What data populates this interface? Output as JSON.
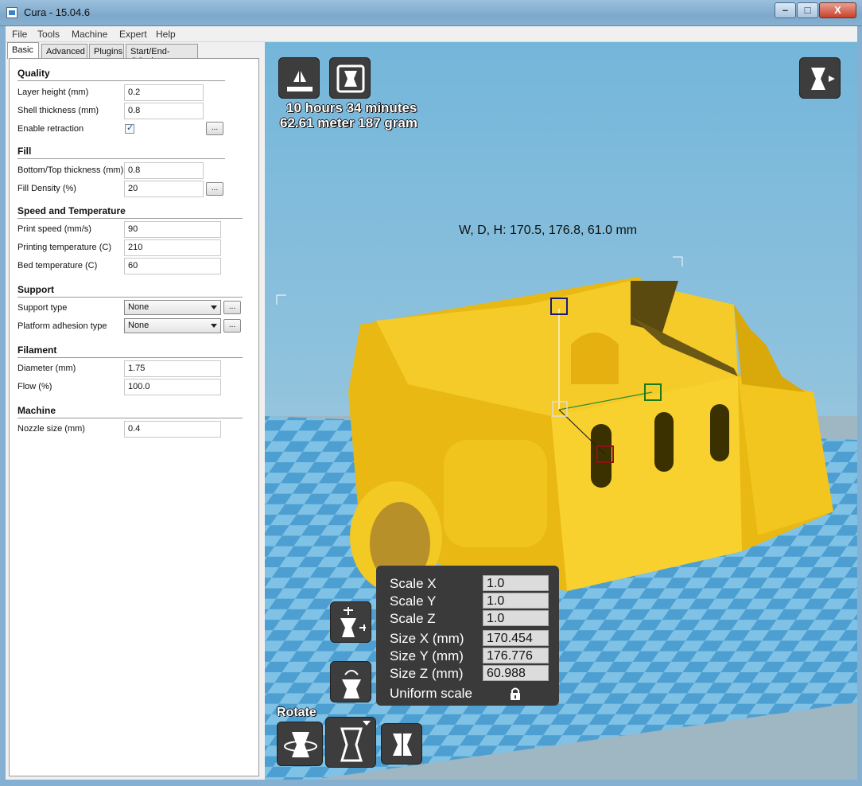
{
  "window": {
    "title": "Cura - 15.04.6",
    "min_label": "–",
    "max_label": "□",
    "close_label": "X"
  },
  "menu": [
    "File",
    "Tools",
    "Machine",
    "Expert",
    "Help"
  ],
  "tabs": [
    "Basic",
    "Advanced",
    "Plugins",
    "Start/End-GCode"
  ],
  "sections": {
    "quality": "Quality",
    "fill": "Fill",
    "speed": "Speed and Temperature",
    "support": "Support",
    "filament": "Filament",
    "machine": "Machine"
  },
  "fields": {
    "layer_height": {
      "label": "Layer height (mm)",
      "value": "0.2"
    },
    "shell_thickness": {
      "label": "Shell thickness (mm)",
      "value": "0.8"
    },
    "enable_retraction": {
      "label": "Enable retraction",
      "checked": true
    },
    "bottom_top": {
      "label": "Bottom/Top thickness (mm)",
      "value": "0.8"
    },
    "fill_density": {
      "label": "Fill Density (%)",
      "value": "20"
    },
    "print_speed": {
      "label": "Print speed (mm/s)",
      "value": "90"
    },
    "print_temp": {
      "label": "Printing temperature (C)",
      "value": "210"
    },
    "bed_temp": {
      "label": "Bed temperature (C)",
      "value": "60"
    },
    "support_type": {
      "label": "Support type",
      "value": "None"
    },
    "adhesion": {
      "label": "Platform adhesion type",
      "value": "None"
    },
    "diameter": {
      "label": "Diameter (mm)",
      "value": "1.75"
    },
    "flow": {
      "label": "Flow (%)",
      "value": "100.0"
    },
    "nozzle": {
      "label": "Nozzle size (mm)",
      "value": "0.4"
    }
  },
  "more_button_label": "...",
  "viewport": {
    "print_time": "10 hours 34 minutes",
    "material": "62.61 meter 187 gram",
    "dimensions": "W, D, H: 170.5, 176.8, 61.0 mm",
    "rotate_label": "Rotate",
    "colors": {
      "model": "#f2c21a",
      "bed_light": "#7fc2e6",
      "bed_dark": "#4d9fd1",
      "panel": "#3a3a3a"
    }
  },
  "scale_panel": {
    "rows": [
      {
        "label": "Scale X",
        "value": "1.0"
      },
      {
        "label": "Scale Y",
        "value": "1.0"
      },
      {
        "label": "Scale Z",
        "value": "1.0"
      },
      {
        "label": "Size X (mm)",
        "value": "170.454"
      },
      {
        "label": "Size Y (mm)",
        "value": "176.776"
      },
      {
        "label": "Size Z (mm)",
        "value": "60.988"
      }
    ],
    "uniform_label": "Uniform scale",
    "uniform_icon": "lock-icon"
  }
}
